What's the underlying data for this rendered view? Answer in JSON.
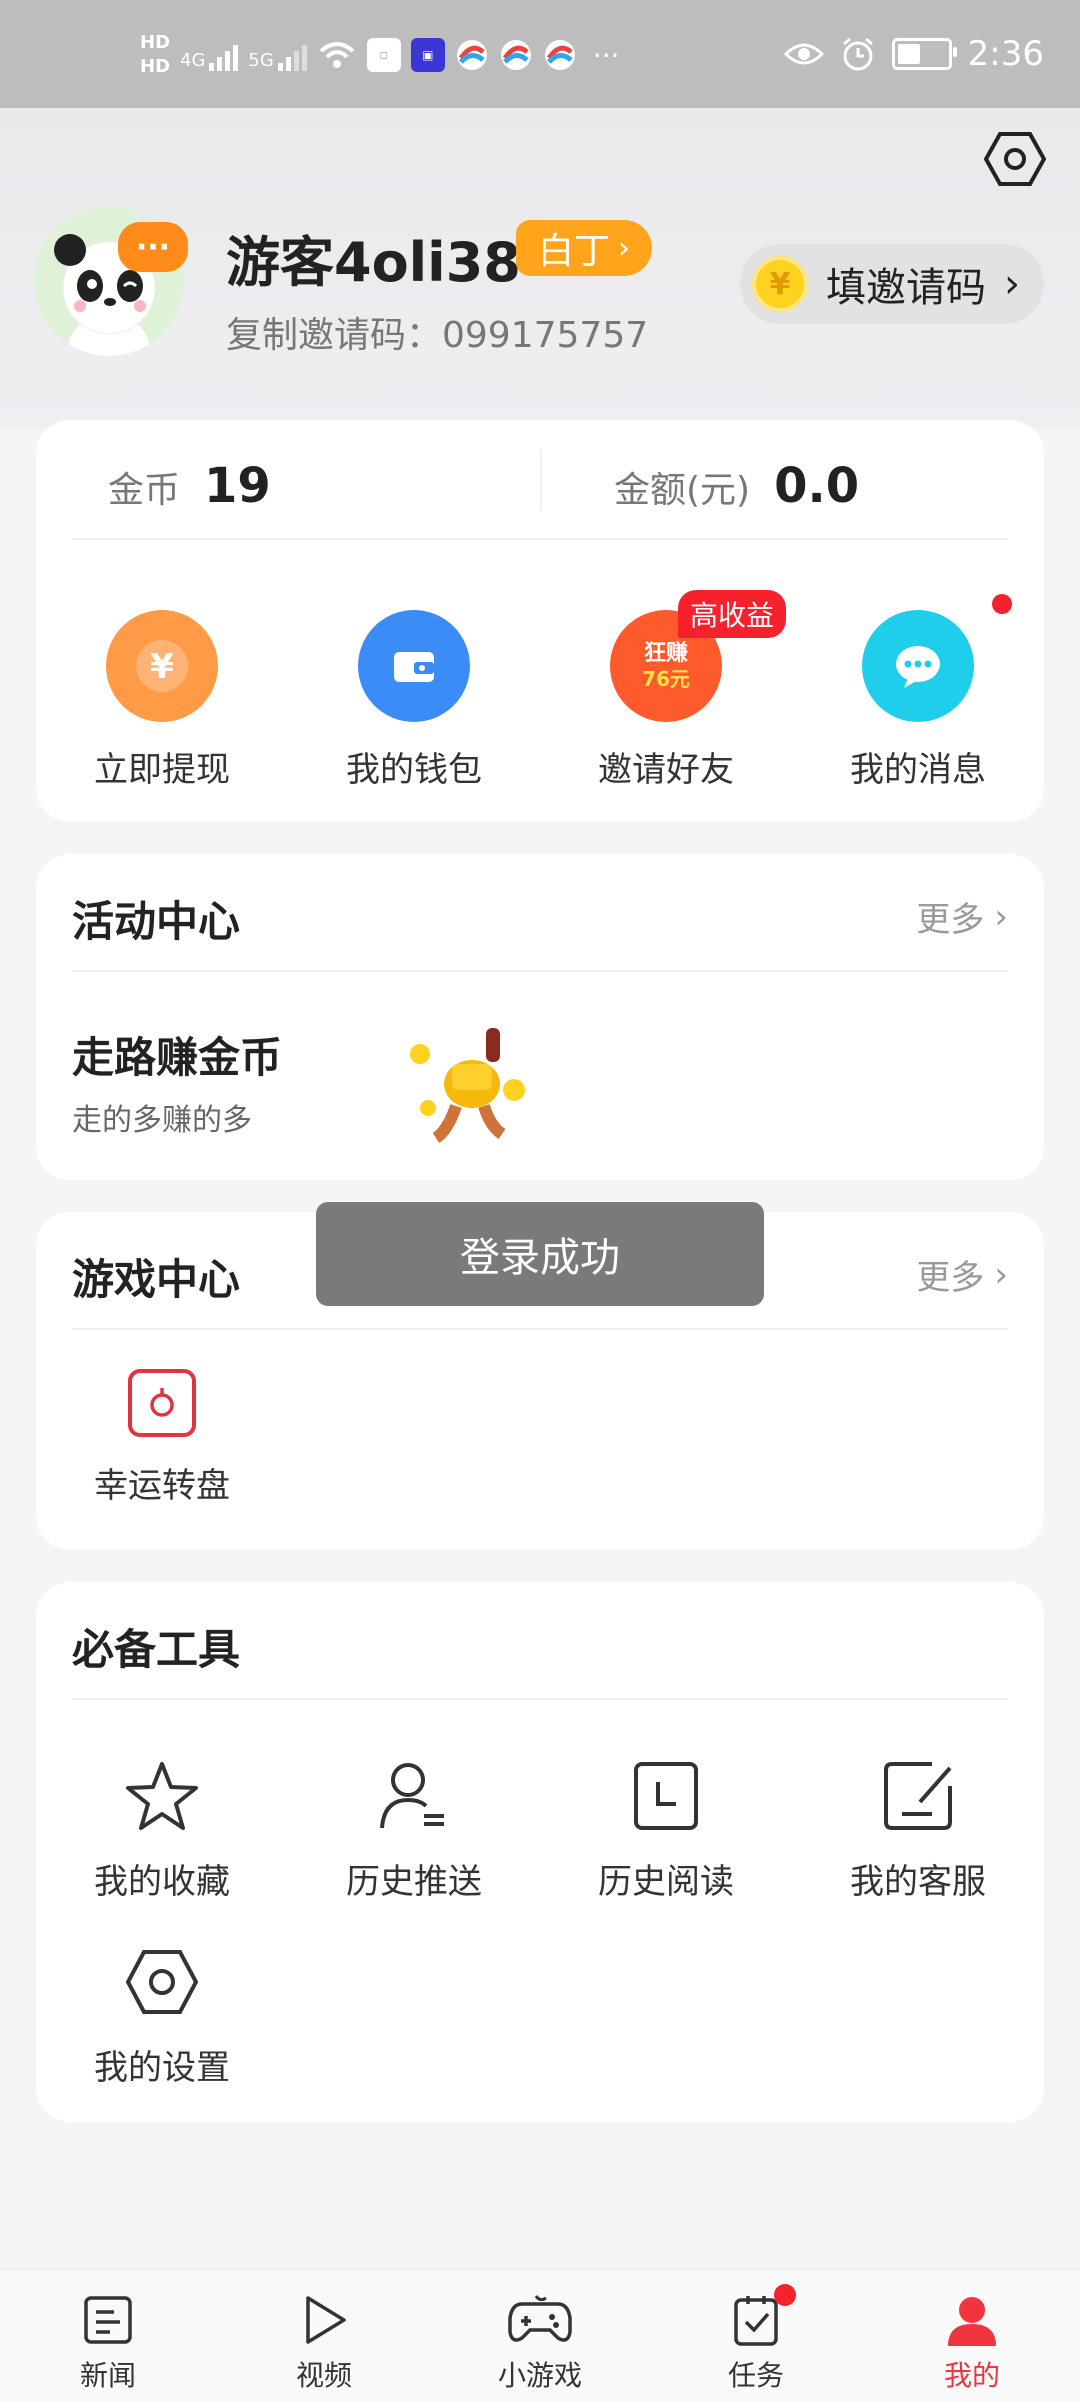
{
  "status_bar": {
    "time": "2:36",
    "hd1": "HD",
    "hd2": "HD",
    "net1": "4G",
    "net2": "5G",
    "more": "···"
  },
  "header": {
    "username": "游客4oli38",
    "rank_label": "白丁",
    "invite_code_text": "复制邀请码：099175757",
    "fill_invite_label": "填邀请码",
    "avatar_bubble": "···",
    "coin_symbol": "¥"
  },
  "stats": {
    "coins_label": "金币",
    "coins_value": "19",
    "amount_label": "金额(元)",
    "amount_value": "0.0"
  },
  "quick_actions": [
    {
      "label": "立即提现",
      "icon": "yuan-icon",
      "color": "#ff9a47"
    },
    {
      "label": "我的钱包",
      "icon": "wallet-icon",
      "color": "#3b8cf6"
    },
    {
      "label": "邀请好友",
      "icon": "invite-icon",
      "color": "#ff5a2c",
      "tag": "高收益",
      "icon_text_1": "狂赚",
      "icon_text_2": "76元"
    },
    {
      "label": "我的消息",
      "icon": "message-icon",
      "color": "#20cdea"
    }
  ],
  "activity": {
    "title": "活动中心",
    "more": "更多",
    "item_title": "走路赚金币",
    "item_subtitle": "走的多赚的多"
  },
  "games": {
    "title": "游戏中心",
    "more": "更多",
    "items": [
      {
        "label": "幸运转盘",
        "icon": "wheel-icon"
      }
    ]
  },
  "toast": "登录成功",
  "tools": {
    "title": "必备工具",
    "items": [
      {
        "label": "我的收藏",
        "icon": "star-icon"
      },
      {
        "label": "历史推送",
        "icon": "user-list-icon"
      },
      {
        "label": "历史阅读",
        "icon": "clock-icon"
      },
      {
        "label": "我的客服",
        "icon": "edit-icon"
      },
      {
        "label": "我的设置",
        "icon": "settings-icon"
      }
    ]
  },
  "bottom_nav": [
    {
      "label": "新闻",
      "icon": "news-icon"
    },
    {
      "label": "视频",
      "icon": "play-icon"
    },
    {
      "label": "小游戏",
      "icon": "gamepad-icon"
    },
    {
      "label": "任务",
      "icon": "task-icon"
    },
    {
      "label": "我的",
      "icon": "profile-icon",
      "active": true
    }
  ],
  "colors": {
    "accent": "#f0353f",
    "rank_badge": "#ffa41b"
  }
}
